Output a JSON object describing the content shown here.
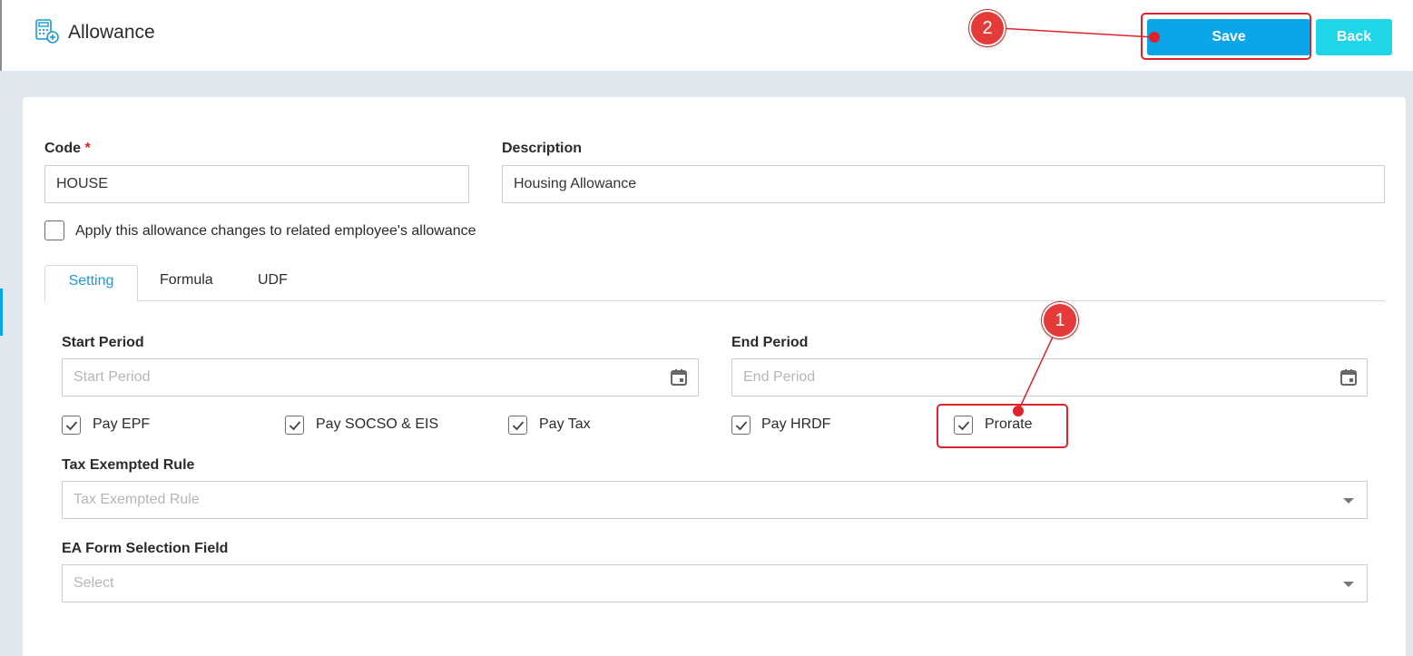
{
  "header": {
    "title": "Allowance",
    "save_label": "Save",
    "back_label": "Back"
  },
  "form": {
    "code_label": "Code",
    "code_required": "*",
    "code_value": "HOUSE",
    "description_label": "Description",
    "description_value": "Housing Allowance",
    "apply_label": "Apply this allowance changes to related employee's allowance",
    "apply_checked": false
  },
  "tabs": [
    {
      "label": "Setting",
      "active": true
    },
    {
      "label": "Formula",
      "active": false
    },
    {
      "label": "UDF",
      "active": false
    }
  ],
  "setting": {
    "start_period_label": "Start Period",
    "start_period_placeholder": "Start Period",
    "end_period_label": "End Period",
    "end_period_placeholder": "End Period",
    "checkboxes": [
      {
        "label": "Pay EPF",
        "checked": true
      },
      {
        "label": "Pay SOCSO & EIS",
        "checked": true
      },
      {
        "label": "Pay Tax",
        "checked": true
      },
      {
        "label": "Pay HRDF",
        "checked": true
      },
      {
        "label": "Prorate",
        "checked": true
      }
    ],
    "tax_rule_label": "Tax Exempted Rule",
    "tax_rule_placeholder": "Tax Exempted Rule",
    "ea_form_label": "EA Form Selection Field",
    "ea_form_placeholder": "Select"
  },
  "annotations": [
    {
      "number": "1"
    },
    {
      "number": "2"
    }
  ],
  "colors": {
    "save_button": "#0aa6e8",
    "back_button": "#1fd6e8",
    "active_tab": "#1a9ad6",
    "annotation": "#e0222a"
  }
}
